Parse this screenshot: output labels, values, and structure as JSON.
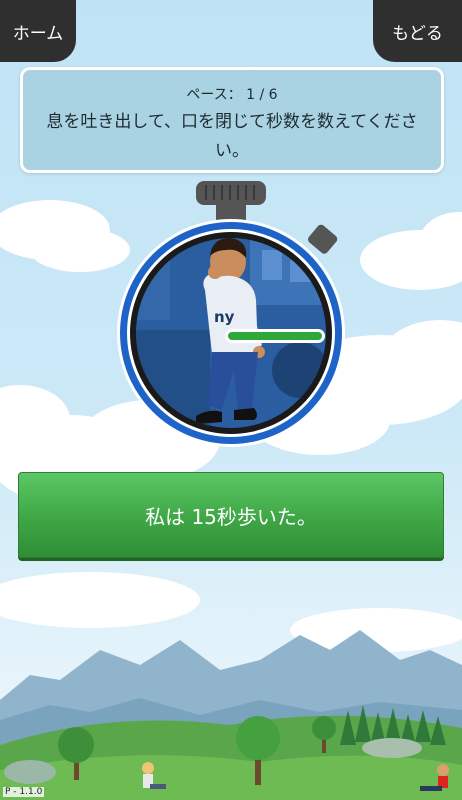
{
  "nav": {
    "home_label": "ホーム",
    "back_label": "もどる"
  },
  "instruction": {
    "pace": "ペース： 1 / 6",
    "text": "息を吐き出して、口を閉じて秒数を数えてください。"
  },
  "timer": {
    "shirt_text": "ny",
    "progress": 1.0
  },
  "action_button": {
    "label": "私は 15秒歩いた。"
  },
  "footer": {
    "version": "P - 1.1.0"
  },
  "colors": {
    "timer_ring": "#1e64c8",
    "button_green": "#3ea645",
    "progress_green": "#2fa83a"
  }
}
